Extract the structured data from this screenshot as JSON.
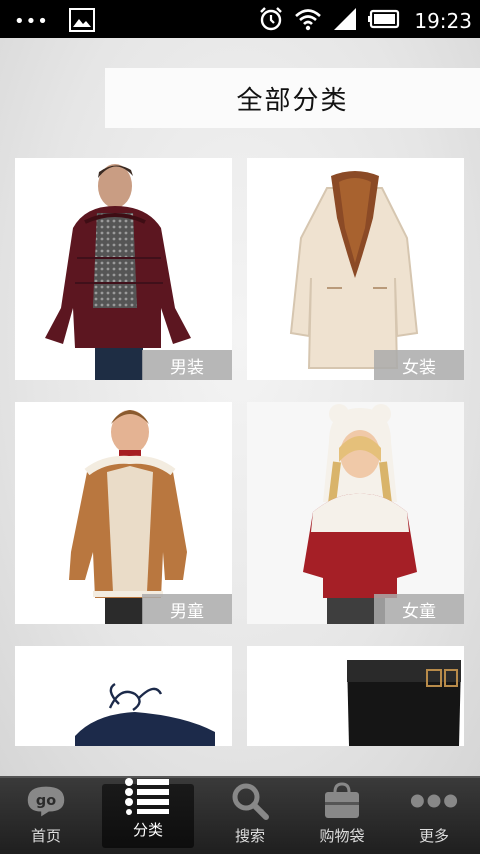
{
  "status_bar": {
    "time": "19:23",
    "icons": [
      "more-dots-icon",
      "image-notification-icon",
      "alarm-icon",
      "wifi-icon",
      "signal-icon",
      "battery-icon"
    ]
  },
  "header": {
    "title": "全部分类"
  },
  "categories": [
    {
      "label": "男装",
      "icon": "men-jacket-photo"
    },
    {
      "label": "女装",
      "icon": "women-coat-photo"
    },
    {
      "label": "男童",
      "icon": "boys-coat-photo"
    },
    {
      "label": "女童",
      "icon": "girls-hoodie-photo"
    },
    {
      "label": "",
      "icon": "shoes-photo"
    },
    {
      "label": "",
      "icon": "boots-photo"
    }
  ],
  "tab_bar": {
    "tabs": [
      {
        "label": "首页",
        "icon": "go-home-icon"
      },
      {
        "label": "分类",
        "icon": "list-icon",
        "active": true
      },
      {
        "label": "搜索",
        "icon": "search-icon"
      },
      {
        "label": "购物袋",
        "icon": "shopping-bag-icon"
      },
      {
        "label": "更多",
        "icon": "more-icon"
      }
    ]
  },
  "colors": {
    "accent_tab_bg": "#111111",
    "label_bg": "#aaaaaa"
  }
}
